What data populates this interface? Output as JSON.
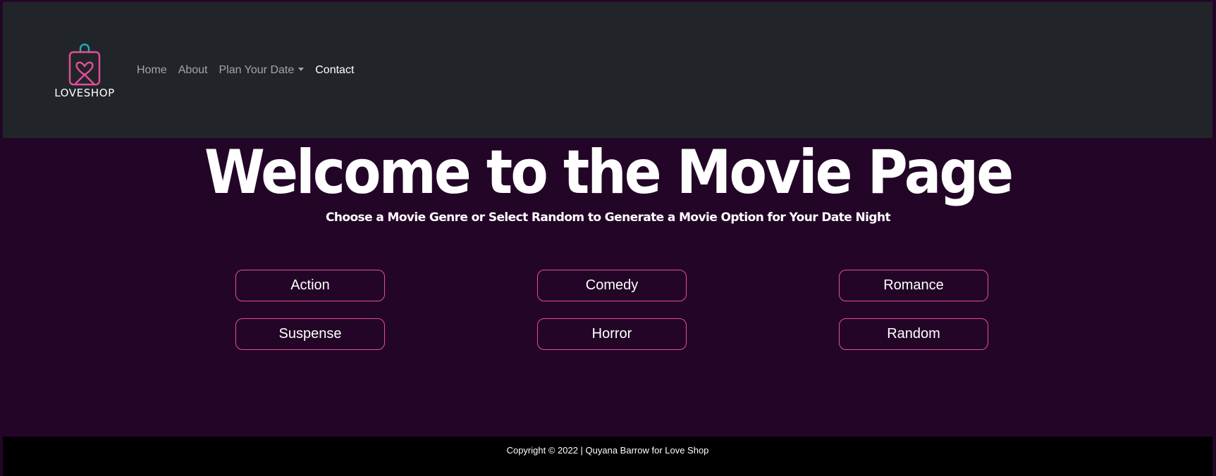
{
  "brand": {
    "name": "LOVESHOP",
    "icon": "shopping-bag-heart-icon",
    "accent": "#e84c9b",
    "handle_color": "#17b3b5"
  },
  "nav": {
    "items": [
      {
        "label": "Home"
      },
      {
        "label": "About"
      },
      {
        "label": "Plan Your Date"
      },
      {
        "label": "Contact"
      }
    ]
  },
  "hero": {
    "title": "Welcome to the Movie Page",
    "subtitle": "Choose a Movie Genre or Select Random to Generate a Movie Option for Your Date Night"
  },
  "genres": {
    "buttons": [
      {
        "label": "Action"
      },
      {
        "label": "Comedy"
      },
      {
        "label": "Romance"
      },
      {
        "label": "Suspense"
      },
      {
        "label": "Horror"
      },
      {
        "label": "Random"
      }
    ]
  },
  "footer": {
    "text": "Copyright © 2022 | Quyana Barrow for Love Shop"
  },
  "colors": {
    "background": "#230627",
    "navbar": "#212529",
    "footer": "#000000",
    "button_border": "#e84c9b"
  }
}
